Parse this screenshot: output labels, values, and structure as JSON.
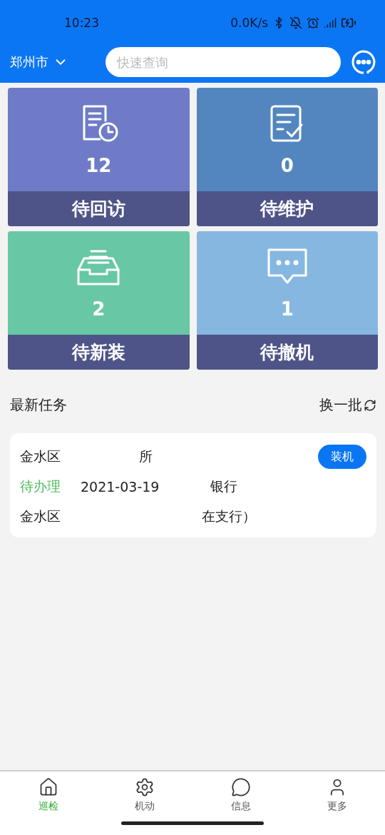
{
  "status_bar": {
    "time": "10:23",
    "speed": "0.0K/s"
  },
  "header": {
    "city": "郑州市",
    "search": {
      "placeholder": "快速查询"
    }
  },
  "tiles": [
    {
      "kind": "visit",
      "count": "12",
      "label": "待回访",
      "color": "#6f7bc6"
    },
    {
      "kind": "maintain",
      "count": "0",
      "label": "待维护",
      "color": "#5386bf"
    },
    {
      "kind": "install",
      "count": "2",
      "label": "待新装",
      "color": "#68c7a4"
    },
    {
      "kind": "remove",
      "count": "1",
      "label": "待撤机",
      "color": "#86b7e0"
    }
  ],
  "section": {
    "title": "最新任务",
    "refresh": "换一批"
  },
  "tasks": [
    {
      "line_1": [
        "金水区",
        "所"
      ],
      "action": "装机",
      "status": "待办理",
      "date": "2021-03-19",
      "line_2_tail": "银行",
      "line_3": [
        "金水区",
        "在支行）"
      ]
    }
  ],
  "tabbar": [
    {
      "kind": "home",
      "label": "巡检",
      "selected": true
    },
    {
      "kind": "gear",
      "label": "机动",
      "selected": false
    },
    {
      "kind": "chat",
      "label": "信息",
      "selected": false
    },
    {
      "kind": "user",
      "label": "更多",
      "selected": false
    }
  ]
}
